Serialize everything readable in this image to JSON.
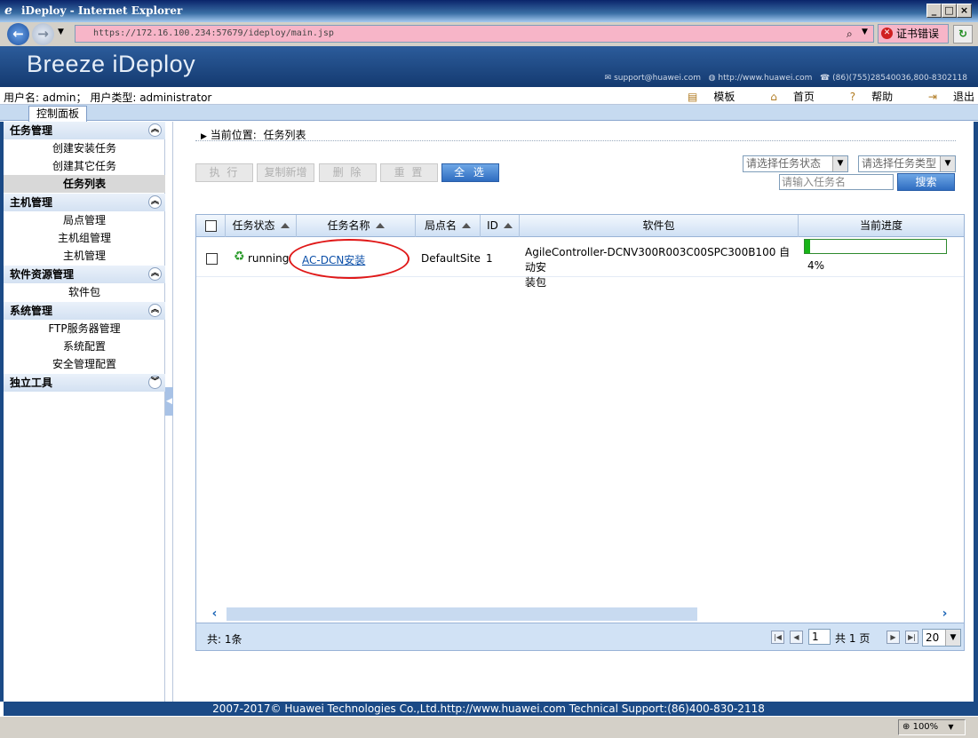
{
  "window": {
    "title": "iDeploy - Internet Explorer"
  },
  "browser": {
    "url": "https://172.16.100.234:57679/ideploy/main.jsp",
    "cert_error": "证书错误",
    "zoom": "100%"
  },
  "banner": {
    "brand": "Breeze iDeploy",
    "email": "support@huawei.com",
    "site": "http://www.huawei.com",
    "phone": "(86)(755)28540036,800-8302118"
  },
  "userbar": {
    "user_label": "用户名:",
    "user": "admin",
    "type_label": "用户类型:",
    "type": "administrator",
    "links": [
      "模板",
      "首页",
      "帮助",
      "退出"
    ]
  },
  "tab": {
    "label": "控制面板"
  },
  "sidebar": {
    "sections": [
      {
        "title": "任务管理",
        "items": [
          "创建安装任务",
          "创建其它任务",
          "任务列表"
        ]
      },
      {
        "title": "主机管理",
        "items": [
          "局点管理",
          "主机组管理",
          "主机管理"
        ]
      },
      {
        "title": "软件资源管理",
        "items": [
          "软件包"
        ]
      },
      {
        "title": "系统管理",
        "items": [
          "FTP服务器管理",
          "系统配置",
          "安全管理配置"
        ]
      },
      {
        "title": "独立工具",
        "items": []
      }
    ],
    "selected": "任务列表"
  },
  "main": {
    "crumb_label": "当前位置:",
    "crumb_value": "任务列表",
    "buttons": [
      "执 行",
      "复制新增",
      "删 除",
      "重 置",
      "全 选"
    ],
    "status_select": "请选择任务状态",
    "type_select": "请选择任务类型",
    "search_placeholder": "请输入任务名",
    "search_button": "搜索"
  },
  "grid": {
    "columns": [
      "任务状态",
      "任务名称",
      "局点名",
      "ID",
      "软件包",
      "当前进度"
    ],
    "rows": [
      {
        "status": "running",
        "name": "AC-DCN安装",
        "site": "DefaultSite",
        "id": "1",
        "package_line1": "AgileController-DCNV300R003C00SPC300B100 自动安",
        "package_line2": "装包",
        "progress_text": "4%",
        "progress": 0.04
      }
    ],
    "total": "共: 1条",
    "page_current": "1",
    "page_total_prefix": "共",
    "page_total": "1",
    "page_total_suffix": "页",
    "page_size": "20"
  },
  "footer": {
    "text": "2007-2017© Huawei Technologies Co.,Ltd.http://www.huawei.com   Technical Support:(86)400-830-2118"
  },
  "colors": {
    "accent": "#2e6cc0",
    "banner": "#1b4a86",
    "progress": "#18b418",
    "annotation": "#e01818"
  }
}
